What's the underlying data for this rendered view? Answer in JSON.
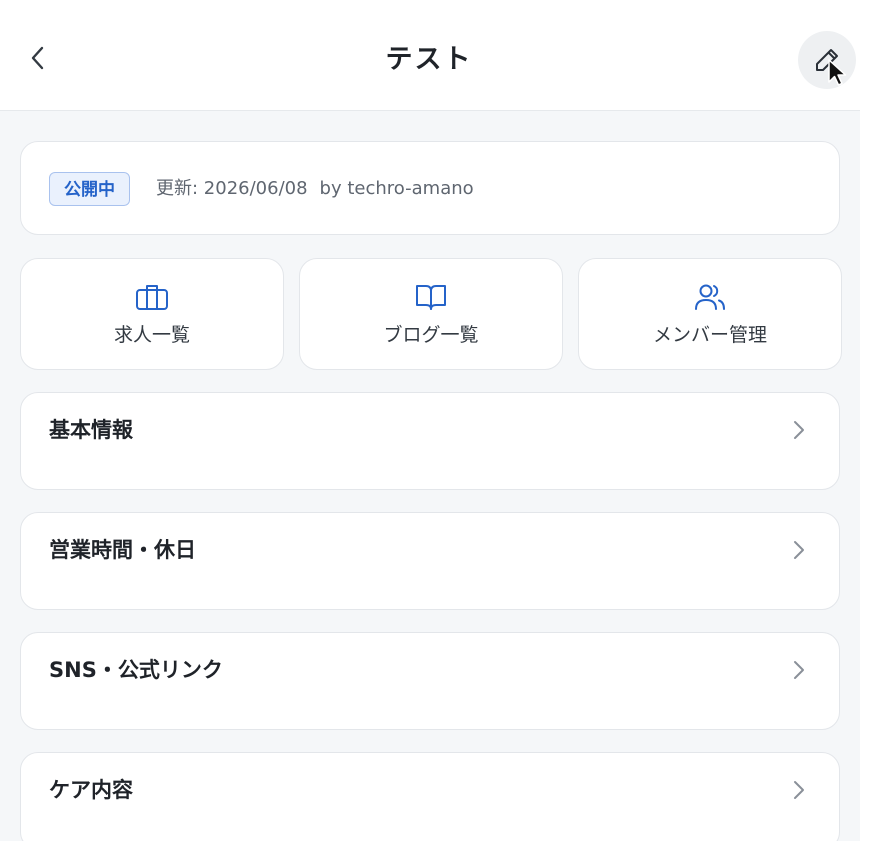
{
  "header": {
    "title": "テスト",
    "back_icon": "chevron-left-icon",
    "edit_icon": "pencil-icon"
  },
  "status": {
    "badge": "公開中",
    "updated": "更新: 2026/06/08",
    "author": "by techro-amano"
  },
  "quick_links": [
    {
      "label": "求人一覧",
      "icon": "briefcase-icon"
    },
    {
      "label": "ブログ一覧",
      "icon": "book-icon"
    },
    {
      "label": "メンバー管理",
      "icon": "users-icon"
    }
  ],
  "sections": [
    {
      "label": "基本情報"
    },
    {
      "label": "営業時間・休日"
    },
    {
      "label": "SNS・公式リンク"
    },
    {
      "label": "ケア内容"
    }
  ],
  "colors": {
    "accent": "#2563c9",
    "badge_bg": "#eaf1fd",
    "content_bg": "#f5f7f9",
    "card_bg": "#ffffff"
  }
}
